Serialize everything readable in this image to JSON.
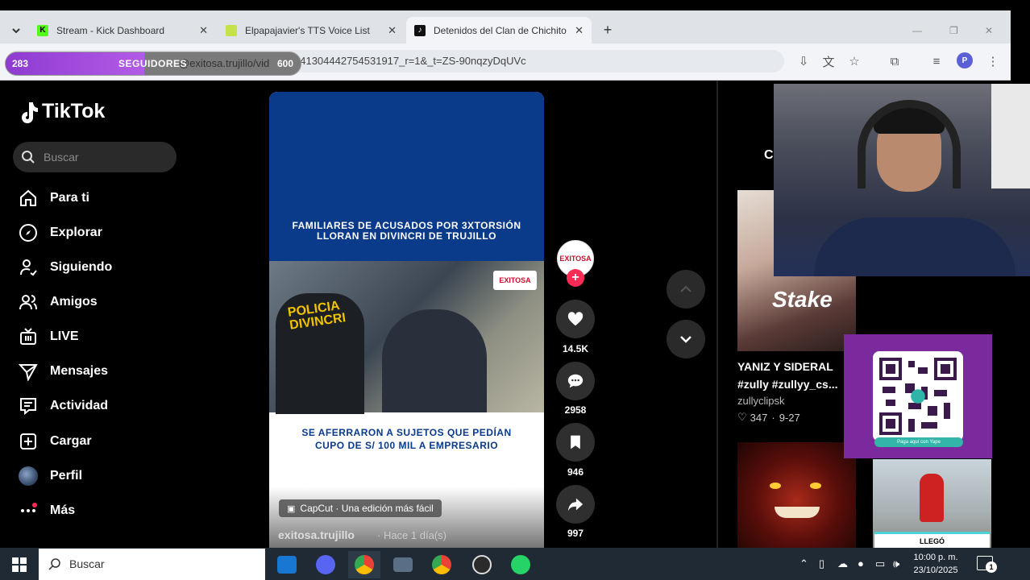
{
  "browser": {
    "tabs": [
      {
        "title": "Stream - Kick Dashboard",
        "favicon": "kick-icon",
        "color": "#53fc18",
        "active": false
      },
      {
        "title": "Elpapajavier's TTS Voice List",
        "favicon": "tts-icon",
        "color": "#c6e24a",
        "active": false
      },
      {
        "title": "Detenidos del Clan de Chichito",
        "favicon": "tiktok-icon",
        "color": "#111111",
        "active": true
      }
    ],
    "url": "641304442754531917_r=1&_t=ZS-90nqzyDqUVc",
    "url_hidden_part": "@exitosa.trujillo/vid",
    "profile_initial": "P"
  },
  "follower_goal": {
    "current": "283",
    "label": "SEGUIDORES",
    "goal": "600",
    "progress": 0.47
  },
  "tiktok": {
    "logo": "TikTok",
    "search_placeholder": "Buscar",
    "nav": [
      {
        "label": "Para ti",
        "icon": "home-icon"
      },
      {
        "label": "Explorar",
        "icon": "compass-icon"
      },
      {
        "label": "Siguiendo",
        "icon": "following-icon"
      },
      {
        "label": "Amigos",
        "icon": "friends-icon"
      },
      {
        "label": "LIVE",
        "icon": "live-icon"
      },
      {
        "label": "Mensajes",
        "icon": "messages-icon"
      },
      {
        "label": "Actividad",
        "icon": "activity-icon"
      },
      {
        "label": "Cargar",
        "icon": "upload-icon"
      },
      {
        "label": "Perfil",
        "icon": "avatar"
      },
      {
        "label": "Más",
        "icon": "more-icon"
      }
    ],
    "video": {
      "headline": "FAMILIARES DE ACUSADOS POR 3XTORSIÓN\nLLORAN EN DIVINCRI DE TRUJILLO",
      "photo_text": "POLICIA\nDIVINCRI",
      "station": "EXITOSA",
      "subheadline": "SE AFERRARON A SUJETOS QUE PEDÍAN\nCUPO DE S/ 100 MIL A EMPRESARIO",
      "capcut": "CapCut · Una edición más fácil",
      "author": "exitosa.trujillo",
      "time": "· Hace 1 día(s)"
    },
    "actions": {
      "likes": "14.5K",
      "comments": "2958",
      "saves": "946",
      "shares": "997"
    },
    "side": {
      "partial_heading": "C",
      "card_title": "YANIZ Y SIDERAL #zully #zullyy_cs...",
      "card_author": "zullyclipsk",
      "card_likes": "347",
      "card_date": "9-27",
      "thumb_brand": "Stake",
      "thumb3_caption": "LLEGÓ"
    }
  },
  "overlay": {
    "qr_caption": "Paga aquí con Yape"
  },
  "taskbar": {
    "search_placeholder": "Buscar",
    "time": "10:00 p. m.",
    "date": "23/10/2025",
    "notif_count": "1"
  }
}
